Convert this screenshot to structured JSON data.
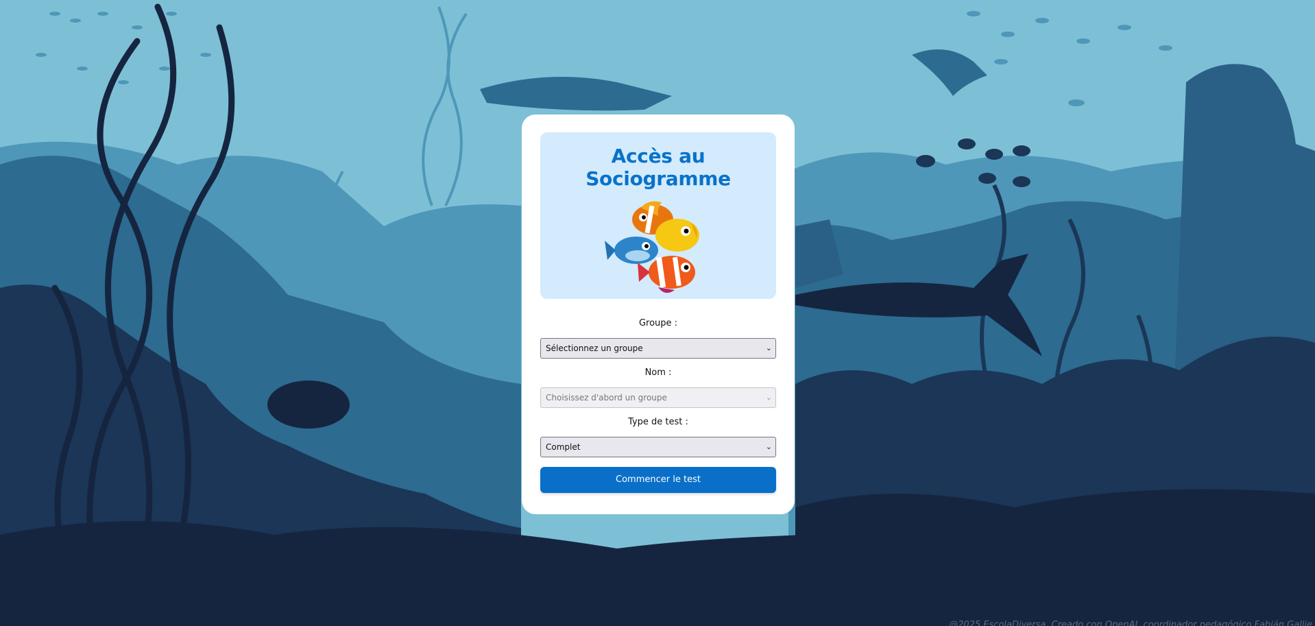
{
  "card": {
    "title": "Accès au Sociogramme",
    "image_icon": "fish-group-icon"
  },
  "form": {
    "group_label": "Groupe :",
    "group_value": "Sélectionnez un groupe",
    "name_label": "Nom :",
    "name_value": "Choisissez d'abord un groupe",
    "test_label": "Type de test :",
    "test_value": "Complet",
    "submit_label": "Commencer le test"
  },
  "footer": {
    "text": "@2025 EscolaDiversa. Creado con OpenAI, coordinador pedagógico Fabián Gallie"
  },
  "colors": {
    "accent": "#0a6fc8",
    "title": "#0a72c9",
    "hero_bg": "#d3ebfd",
    "water_light": "#7dc0d6",
    "water_dark": "#152540"
  }
}
